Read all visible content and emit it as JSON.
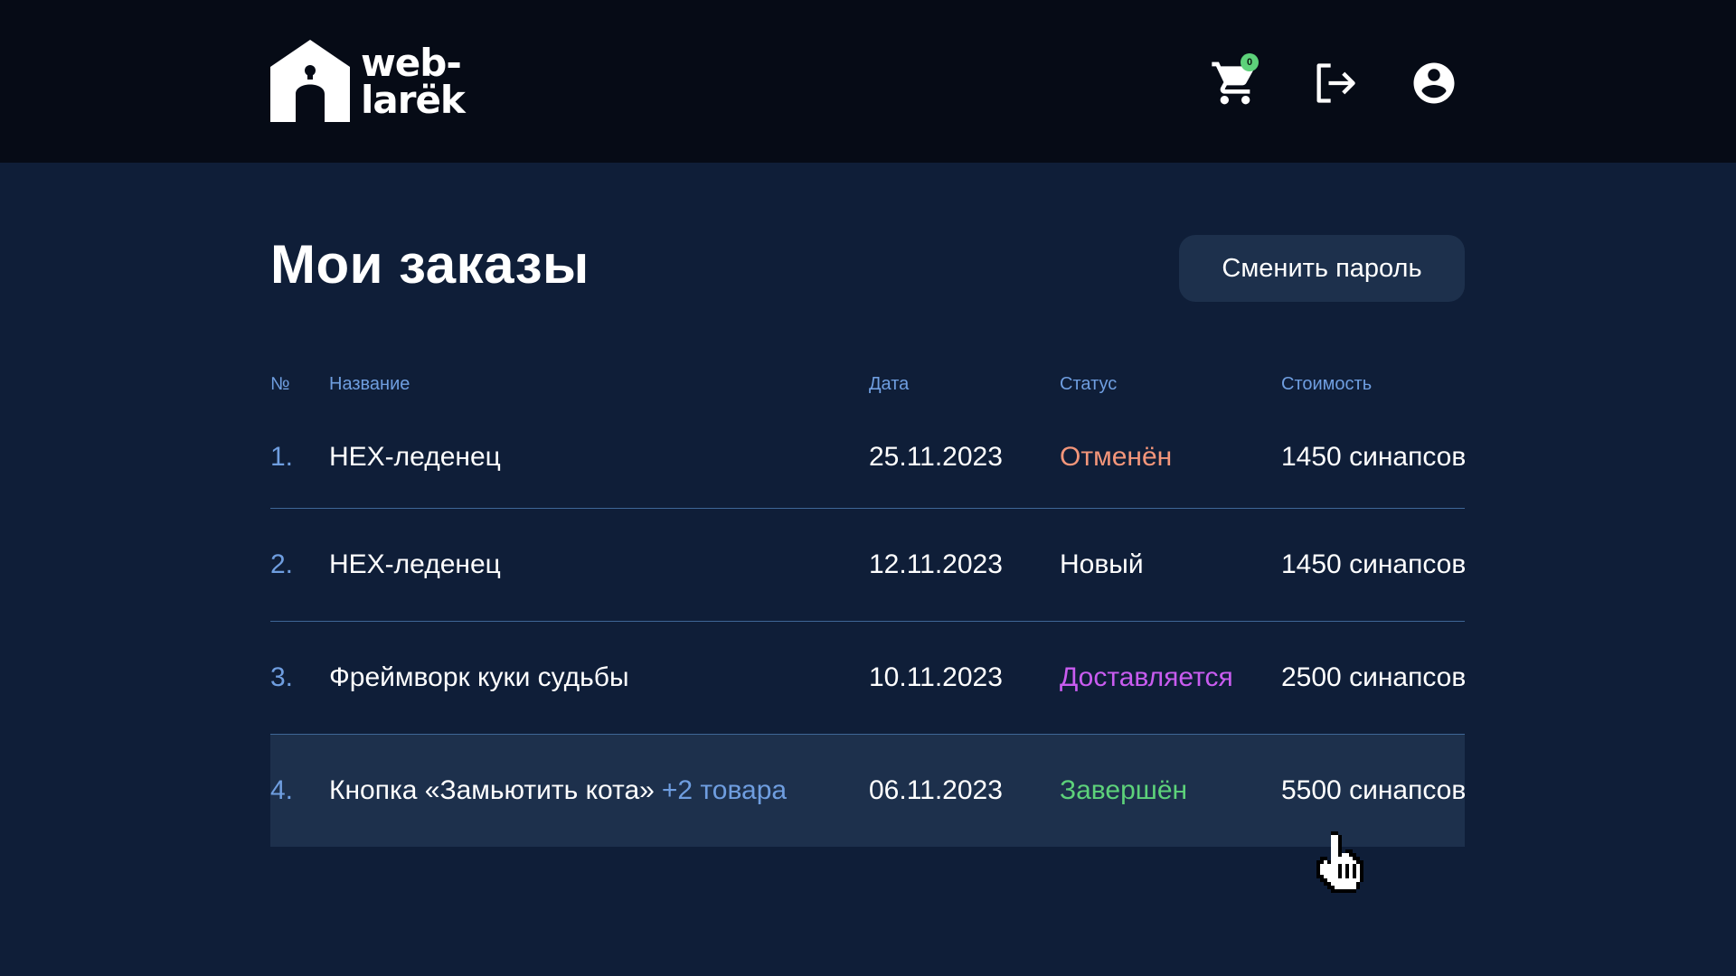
{
  "header": {
    "logo_line1": "web-",
    "logo_line2": "larëk",
    "cart_count": "0",
    "icons": [
      "cart-icon",
      "logout-icon",
      "account-icon"
    ]
  },
  "page": {
    "title": "Мои заказы",
    "change_password_label": "Сменить пароль"
  },
  "table": {
    "columns": [
      "№",
      "Название",
      "Дата",
      "Статус",
      "Стоимость"
    ],
    "rows": [
      {
        "num": "1.",
        "name": "HEX-леденец",
        "extra": "",
        "date": "25.11.2023",
        "status": "Отменён",
        "status_color": "#f4967a",
        "price": "1450 синапсов"
      },
      {
        "num": "2.",
        "name": "HEX-леденец",
        "extra": "",
        "date": "12.11.2023",
        "status": "Новый",
        "status_color": "#ffffff",
        "price": "1450 синапсов"
      },
      {
        "num": "3.",
        "name": "Фреймворк куки судьбы",
        "extra": "",
        "date": "10.11.2023",
        "status": "Доставляется",
        "status_color": "#c95cf0",
        "price": "2500 синапсов"
      },
      {
        "num": "4.",
        "name": "Кнопка «Замьютить кота»",
        "extra": "+2 товара",
        "date": "06.11.2023",
        "status": "Завершён",
        "status_color": "#5dd27a",
        "price": "5500 синапсов"
      }
    ]
  },
  "colors": {
    "background": "#0f1e38",
    "topbar": "#060b16",
    "accent": "#6f9ee0",
    "selected_row": "#1d304c"
  }
}
